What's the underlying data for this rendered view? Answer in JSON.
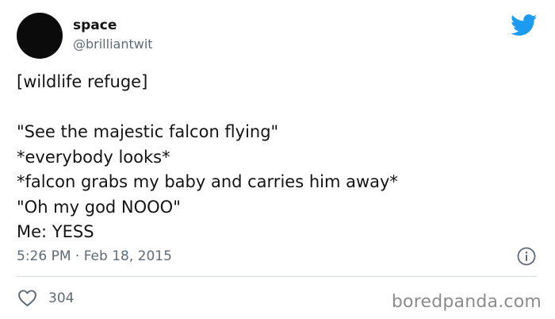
{
  "author": {
    "display_name": "space",
    "handle": "@brilliantwit"
  },
  "tweet": {
    "lines": [
      "[wildlife refuge]",
      "",
      "\"See the majestic falcon flying\"",
      "*everybody looks*",
      "*falcon grabs my baby and carries him away*",
      "\"Oh my god NOOO\"",
      "Me: YESS"
    ],
    "timestamp": "5:26 PM · Feb 18, 2015"
  },
  "engagement": {
    "likes": "304"
  },
  "watermark": "boredpanda.com",
  "icons": {
    "brand": "twitter-bird-icon",
    "info": "info-icon",
    "like": "heart-icon"
  },
  "colors": {
    "twitter_blue": "#1d9bf0",
    "secondary_text": "#5f6b76",
    "avatar": "#0b0b0b"
  }
}
